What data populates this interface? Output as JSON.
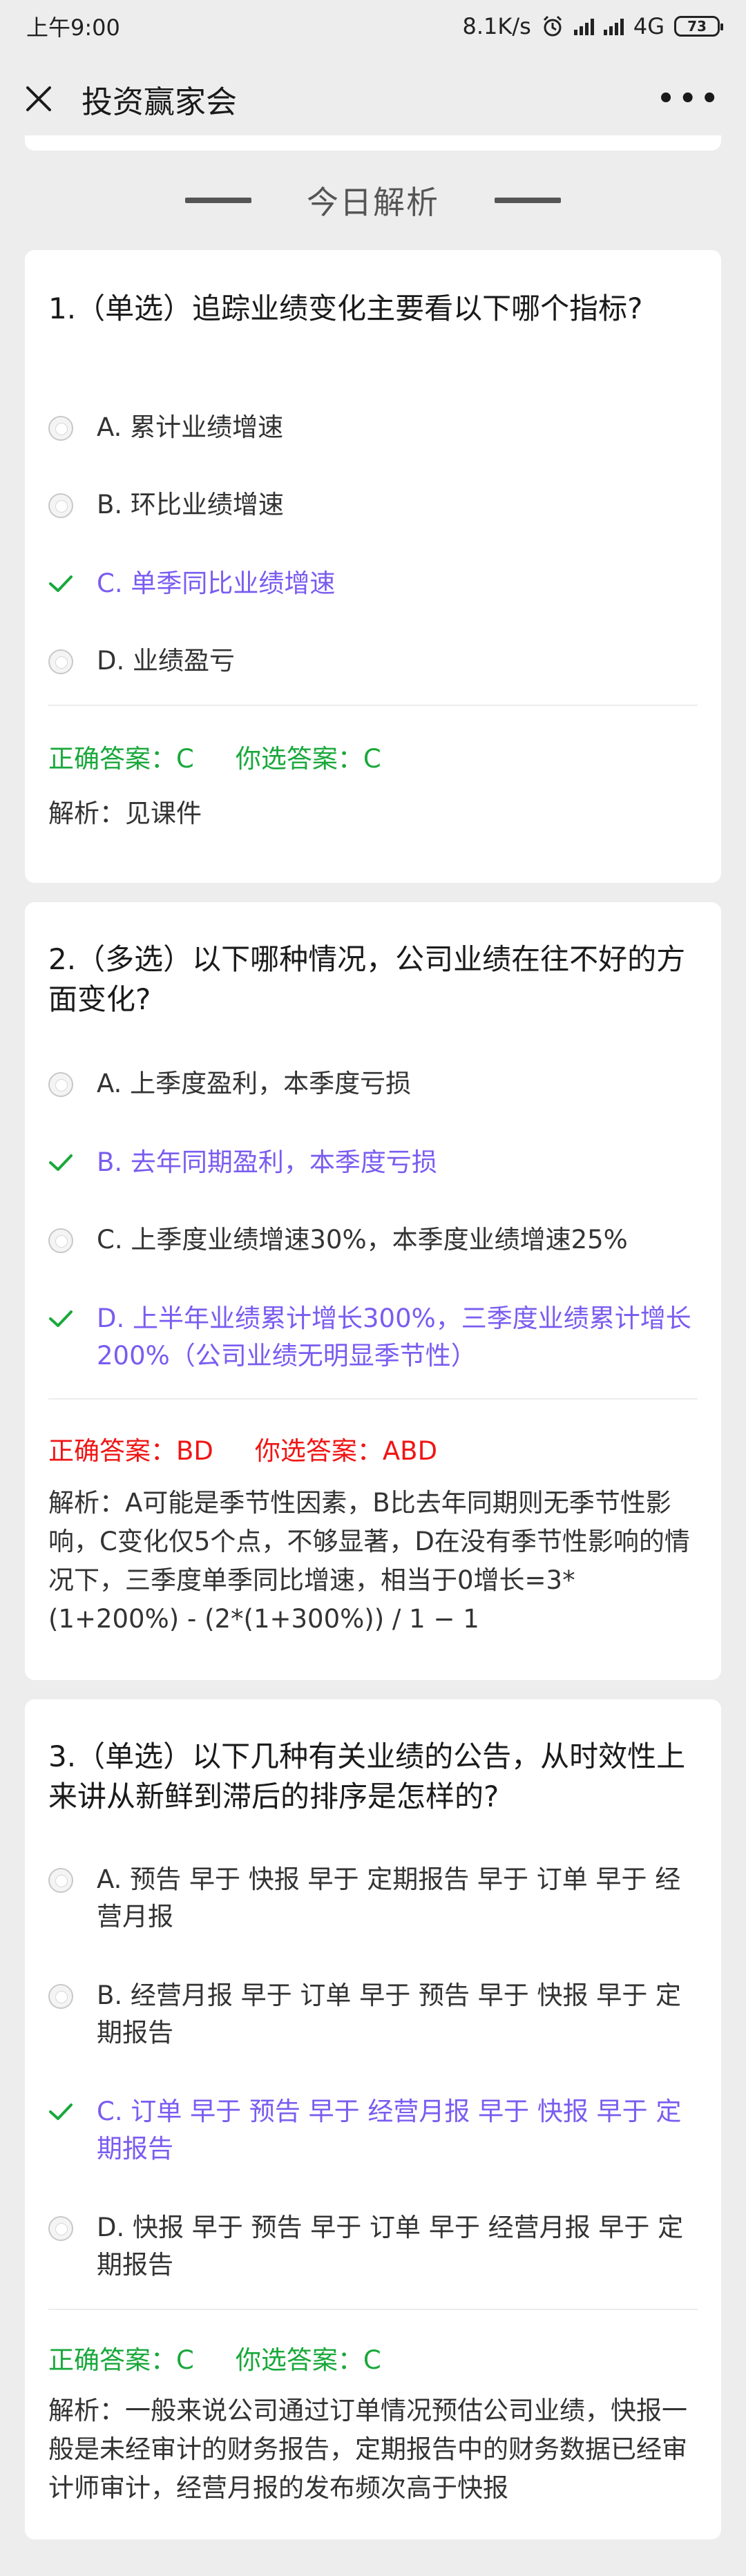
{
  "status": {
    "time": "上午9:00",
    "speed": "8.1K/s",
    "network": "4G",
    "battery": "73"
  },
  "nav": {
    "title": "投资赢家会"
  },
  "section": {
    "title": "今日解析"
  },
  "colors": {
    "correct": "#19a83b",
    "wrong": "#f01515",
    "selected": "#7a5cf0"
  },
  "questions": [
    {
      "title": "1.（单选）追踪业绩变化主要看以下哪个指标?",
      "options": [
        {
          "label": "A. 累计业绩增速",
          "selected": false
        },
        {
          "label": "B. 环比业绩增速",
          "selected": false
        },
        {
          "label": "C. 单季同比业绩增速",
          "selected": true
        },
        {
          "label": "D. 业绩盈亏",
          "selected": false
        }
      ],
      "correct_answer": "正确答案：C",
      "your_answer": "你选答案：C",
      "is_correct": true,
      "analysis": "解析：见课件"
    },
    {
      "title": "2.（多选）以下哪种情况，公司业绩在往不好的方面变化?",
      "options": [
        {
          "label": "A. 上季度盈利，本季度亏损",
          "selected": true
        },
        {
          "label": "B. 去年同期盈利，本季度亏损",
          "selected": true
        },
        {
          "label": "C. 上季度业绩增速30%，本季度业绩增速25%",
          "selected": false
        },
        {
          "label": "D. 上半年业绩累计增长300%，三季度业绩累计增长200%（公司业绩无明显季节性）",
          "selected": true
        }
      ],
      "correct_answer": "正确答案：BD",
      "your_answer": "你选答案：ABD",
      "is_correct": false,
      "analysis": "解析：A可能是季节性因素，B比去年同期则无季节性影响，C变化仅5个点，不够显著，D在没有季节性影响的情况下，三季度单季同比增速，相当于0增长=3*(1+200%) - (2*(1+300%)) / 1 − 1"
    },
    {
      "title": "3.（单选）以下几种有关业绩的公告，从时效性上来讲从新鲜到滞后的排序是怎样的?",
      "options": [
        {
          "label": "A. 预告 早于 快报 早于 定期报告 早于 订单 早于 经营月报",
          "selected": false
        },
        {
          "label": "B. 经营月报 早于 订单 早于 预告 早于 快报 早于 定期报告",
          "selected": false
        },
        {
          "label": "C. 订单 早于 预告 早于 经营月报 早于 快报 早于 定期报告",
          "selected": true
        },
        {
          "label": "D. 快报 早于 预告 早于 订单 早于 经营月报 早于 定期报告",
          "selected": false
        }
      ],
      "correct_answer": "正确答案：C",
      "your_answer": "你选答案：C",
      "is_correct": true,
      "analysis": "解析：一般来说公司通过订单情况预估公司业绩，快报一般是未经审计的财务报告，定期报告中的财务数据已经审计师审计，经营月报的发布频次高于快报"
    }
  ]
}
